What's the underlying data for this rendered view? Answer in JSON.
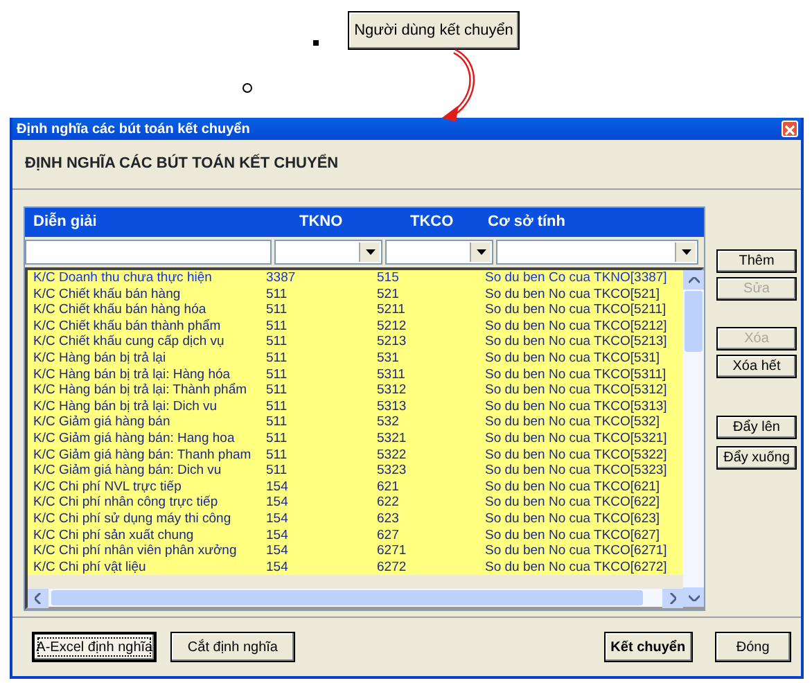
{
  "top_button": {
    "label": "Người dùng kết chuyển"
  },
  "window": {
    "title": "Định nghĩa các bút toán kết chuyển"
  },
  "heading": "ĐỊNH NGHĨA CÁC BÚT TOÁN KẾT CHUYỂN",
  "grid": {
    "columns": [
      "Diễn giải",
      "TKNO",
      "TKCO",
      "Cơ sở tính"
    ],
    "filters": [
      {
        "kind": "text"
      },
      {
        "kind": "combo"
      },
      {
        "kind": "combo"
      },
      {
        "kind": "combo"
      }
    ],
    "rows": [
      {
        "cells": [
          "K/C Doanh thu chưa thực hiện",
          "3387",
          "515",
          "So du ben Co cua TKNO[3387]"
        ],
        "selected": true
      },
      {
        "cells": [
          "K/C Chiết khấu bán hàng",
          "511",
          "521",
          "So du ben No cua TKCO[521]"
        ],
        "selected": false
      },
      {
        "cells": [
          "K/C Chiết khấu bán hàng hóa",
          "511",
          "5211",
          "So du ben No cua TKCO[5211]"
        ],
        "selected": false
      },
      {
        "cells": [
          "K/C Chiết khấu bán thành phẩm",
          "511",
          "5212",
          "So du ben No cua TKCO[5212]"
        ],
        "selected": false
      },
      {
        "cells": [
          "K/C Chiết khấu cung cấp dịch vụ",
          "511",
          "5213",
          "So du ben No cua TKCO[5213]"
        ],
        "selected": false
      },
      {
        "cells": [
          "K/C Hàng bán bị trả lại",
          "511",
          "531",
          "So du ben No cua TKCO[531]"
        ],
        "selected": false
      },
      {
        "cells": [
          "K/C Hàng bán bị trả lại: Hàng hóa",
          "511",
          "5311",
          "So du ben No cua TKCO[5311]"
        ],
        "selected": false
      },
      {
        "cells": [
          "K/C Hàng bán bị trả lại: Thành phẩm",
          "511",
          "5312",
          "So du ben No cua TKCO[5312]"
        ],
        "selected": false
      },
      {
        "cells": [
          "K/C Hàng bán bị trả lại: Dich vu",
          "511",
          "5313",
          "So du ben No cua TKCO[5313]"
        ],
        "selected": false
      },
      {
        "cells": [
          "K/C Giảm giá hàng bán",
          "511",
          "532",
          "So du ben No cua TKCO[532]"
        ],
        "selected": false
      },
      {
        "cells": [
          "K/C Giảm giá hàng bán: Hang hoa",
          "511",
          "5321",
          "So du ben No cua TKCO[5321]"
        ],
        "selected": false
      },
      {
        "cells": [
          "K/C Giảm giá hàng bán: Thanh pham",
          "511",
          "5322",
          "So du ben No cua TKCO[5322]"
        ],
        "selected": false
      },
      {
        "cells": [
          "K/C Giảm giá hàng bán: Dich vu",
          "511",
          "5323",
          "So du ben No cua TKCO[5323]"
        ],
        "selected": false
      },
      {
        "cells": [
          "K/C Chi phí NVL trực tiếp",
          "154",
          "621",
          "So du ben No cua TKCO[621]"
        ],
        "selected": false
      },
      {
        "cells": [
          "K/C Chi phí nhân công trực tiếp",
          "154",
          "622",
          "So du ben No cua TKCO[622]"
        ],
        "selected": false
      },
      {
        "cells": [
          "K/C Chi phí sử dụng máy thi công",
          "154",
          "623",
          "So du ben No cua TKCO[623]"
        ],
        "selected": false
      },
      {
        "cells": [
          "K/C Chi phí sản xuất chung",
          "154",
          "627",
          "So du ben No cua TKCO[627]"
        ],
        "selected": false
      },
      {
        "cells": [
          "K/C Chi phí nhân viên phân xưởng",
          "154",
          "6271",
          "So du ben No cua TKCO[6271]"
        ],
        "selected": false
      },
      {
        "cells": [
          "K/C Chi phí vật liệu",
          "154",
          "6272",
          "So du ben No cua TKCO[6272]"
        ],
        "selected": false
      }
    ]
  },
  "side_buttons": [
    {
      "label": "Thêm",
      "disabled": false
    },
    {
      "label": "Sửa",
      "disabled": true
    },
    {
      "label": "Xóa",
      "disabled": true
    },
    {
      "label": "Xóa hết",
      "disabled": false
    },
    {
      "label": "Đẩy lên",
      "disabled": false
    },
    {
      "label": "Đẩy xuống",
      "disabled": false
    }
  ],
  "footer_buttons": [
    {
      "label": "A-Excel định nghĩa",
      "focused": true,
      "bold": false
    },
    {
      "label": "Cắt định nghĩa",
      "focused": false,
      "bold": false
    },
    {
      "label": "Kết chuyển",
      "focused": false,
      "bold": true
    },
    {
      "label": "Đóng",
      "focused": false,
      "bold": false
    }
  ]
}
